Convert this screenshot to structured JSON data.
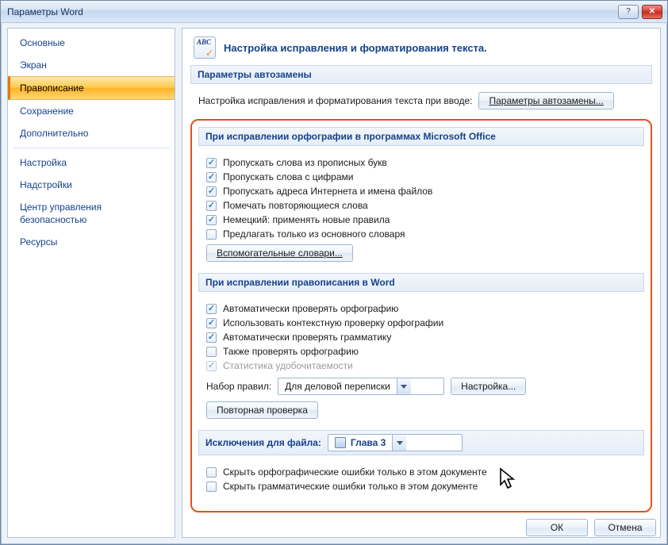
{
  "window": {
    "title": "Параметры Word"
  },
  "sidebar": {
    "groups": [
      [
        {
          "key": "general",
          "label": "Основные"
        },
        {
          "key": "display",
          "label": "Экран"
        },
        {
          "key": "proofing",
          "label": "Правописание",
          "selected": true
        },
        {
          "key": "save",
          "label": "Сохранение"
        },
        {
          "key": "advanced",
          "label": "Дополнительно"
        }
      ],
      [
        {
          "key": "customize",
          "label": "Настройка"
        },
        {
          "key": "addins",
          "label": "Надстройки"
        },
        {
          "key": "trust",
          "label": "Центр управления безопасностью"
        },
        {
          "key": "resources",
          "label": "Ресурсы"
        }
      ]
    ]
  },
  "header": {
    "icon": "abc-check",
    "title": "Настройка исправления и форматирования текста."
  },
  "autocorrect": {
    "heading": "Параметры автозамены",
    "intro": "Настройка исправления и форматирования текста при вводе:",
    "options_button": "Параметры автозамены..."
  },
  "office_spelling": {
    "heading": "При исправлении орфографии в программах Microsoft Office",
    "checks": [
      {
        "key": "uppercase",
        "label": "Пропускать слова из прописных букв",
        "checked": true
      },
      {
        "key": "digits",
        "label": "Пропускать слова с цифрами",
        "checked": true
      },
      {
        "key": "internet",
        "label": "Пропускать адреса Интернета и имена файлов",
        "checked": true
      },
      {
        "key": "repeated",
        "label": "Помечать повторяющиеся слова",
        "checked": true
      },
      {
        "key": "german",
        "label": "Немецкий: применять новые правила",
        "checked": true
      },
      {
        "key": "maindict",
        "label": "Предлагать только из основного словаря",
        "checked": false
      }
    ],
    "custom_dict_button": "Вспомогательные словари..."
  },
  "word_spelling": {
    "heading": "При исправлении правописания в Word",
    "checks": [
      {
        "key": "spell_auto",
        "label": "Автоматически проверять орфографию",
        "checked": true
      },
      {
        "key": "contextual",
        "label": "Использовать контекстную проверку орфографии",
        "checked": true
      },
      {
        "key": "grammar_auto",
        "label": "Автоматически проверять грамматику",
        "checked": true
      },
      {
        "key": "also_spell",
        "label": "Также проверять орфографию",
        "checked": false
      },
      {
        "key": "readability",
        "label": "Статистика удобочитаемости",
        "checked": true,
        "disabled": true
      }
    ],
    "ruleset_label": "Набор правил:",
    "ruleset_value": "Для деловой переписки",
    "settings_button": "Настройка...",
    "recheck_button": "Повторная проверка"
  },
  "exceptions": {
    "heading": "Исключения для файла:",
    "file_value": "Глава 3",
    "checks": [
      {
        "key": "hide_spell",
        "label": "Скрыть орфографические ошибки только в этом документе",
        "checked": false
      },
      {
        "key": "hide_grammar",
        "label": "Скрыть грамматические ошибки только в этом документе",
        "checked": false
      }
    ]
  },
  "footer": {
    "ok": "ОК",
    "cancel": "Отмена"
  },
  "colors": {
    "accent": "#e3521e",
    "link": "#15428b"
  }
}
